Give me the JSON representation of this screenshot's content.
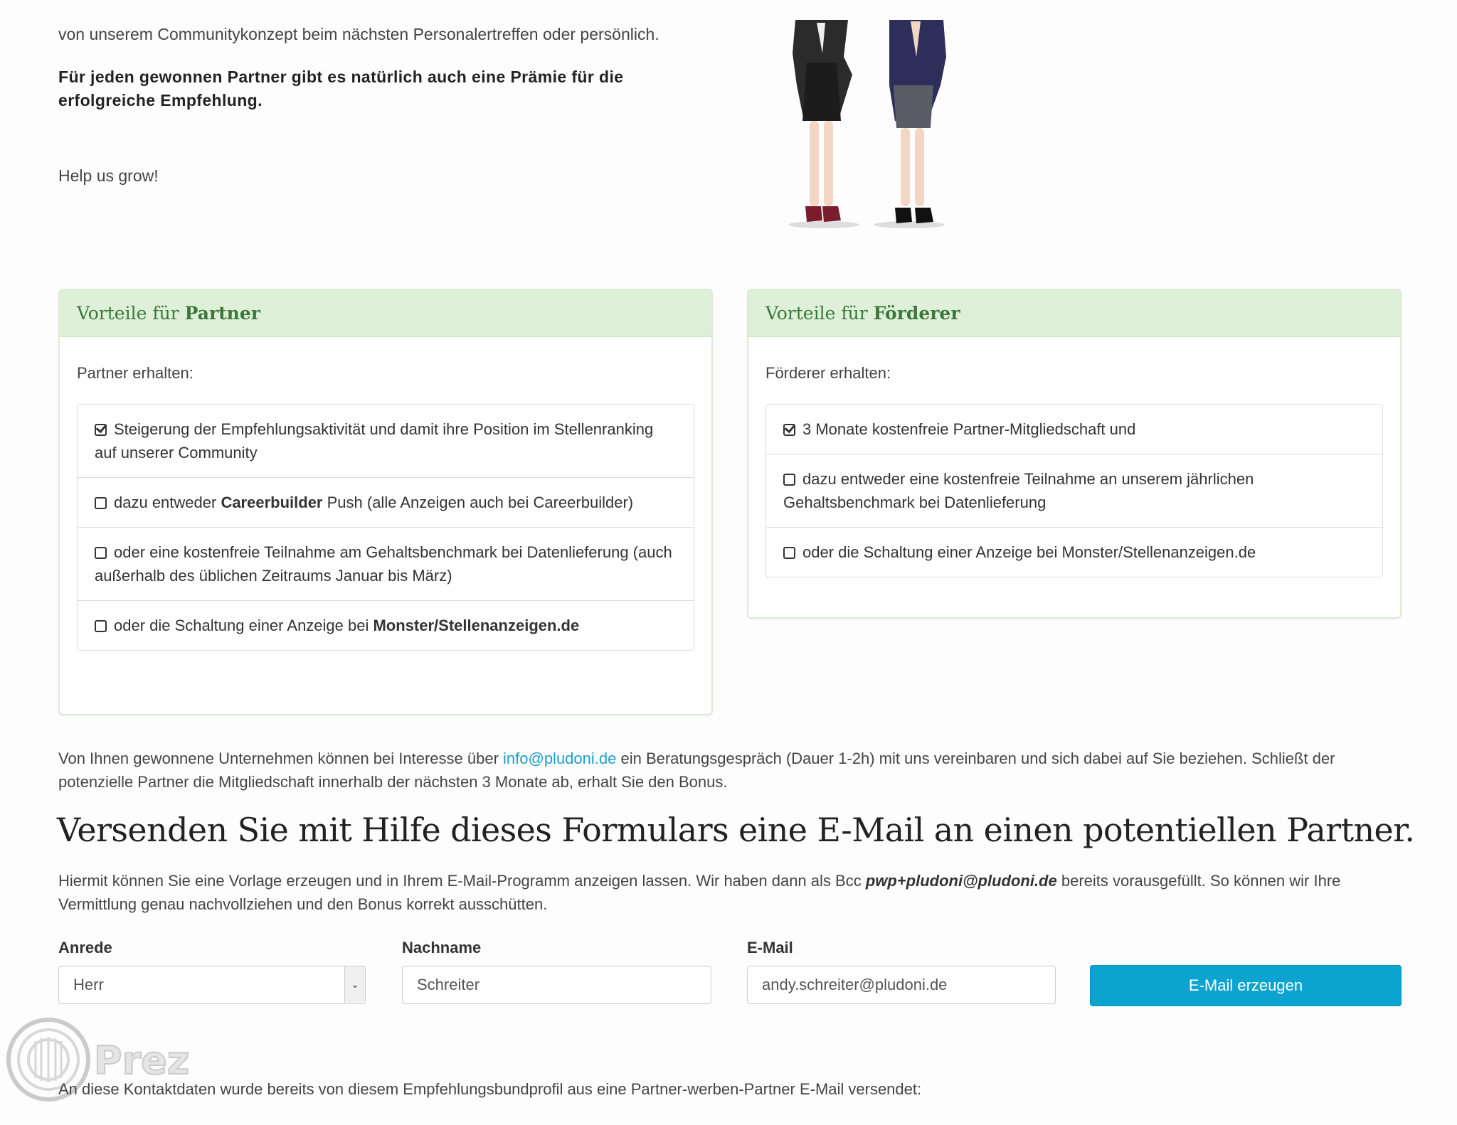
{
  "intro": {
    "text": "von unserem Communitykonzept beim nächsten Personalertreffen oder persönlich.",
    "bold": "Für jeden gewonnen Partner gibt es natürlich auch eine Prämie für die erfolgreiche Empfehlung.",
    "help": "Help us grow!"
  },
  "illustration": {
    "icon": "two-businesswomen-illustration"
  },
  "partner": {
    "title_prefix": "Vorteile für",
    "title_bold": "Partner",
    "lead": "Partner erhalten:",
    "items": [
      {
        "checked": true,
        "text": "Steigerung der Empfehlungsaktivität und damit ihre Position im Stellenranking auf unserer Community"
      },
      {
        "checked": false,
        "pre": "dazu entweder ",
        "bold": "Careerbuilder",
        "post": " Push (alle Anzeigen auch bei Careerbuilder)"
      },
      {
        "checked": false,
        "text": "oder eine kostenfreie Teilnahme am Gehaltsbenchmark bei Datenlieferung (auch außerhalb des üblichen Zeitraums Januar bis März)"
      },
      {
        "checked": false,
        "pre": "oder die Schaltung einer Anzeige bei ",
        "bold": "Monster/Stellenanzeigen.de",
        "post": ""
      }
    ]
  },
  "foerderer": {
    "title_prefix": "Vorteile für",
    "title_bold": "Förderer",
    "lead": "Förderer erhalten:",
    "items": [
      {
        "checked": true,
        "text": "3 Monate kostenfreie Partner-Mitgliedschaft und"
      },
      {
        "checked": false,
        "text": "dazu entweder eine kostenfreie Teilnahme an unserem jährlichen Gehaltsbenchmark bei Datenlieferung"
      },
      {
        "checked": false,
        "text": "oder die Schaltung einer Anzeige bei Monster/Stellenanzeigen.de"
      }
    ]
  },
  "info": {
    "pre": "Von Ihnen gewonnene Unternehmen können bei Interesse über ",
    "link": "info@pludoni.de",
    "post": " ein Beratungsgespräch (Dauer 1-2h) mit uns vereinbaren und sich dabei auf Sie beziehen. Schließt der potenzielle Partner die Mitgliedschaft innerhalb der nächsten 3 Monate ab, erhalt Sie den Bonus."
  },
  "form_section": {
    "heading": "Versenden Sie mit Hilfe dieses Formulars eine E-Mail an einen potentiellen Partner.",
    "desc_pre": "Hiermit können Sie eine Vorlage erzeugen und in Ihrem E-Mail-Programm anzeigen lassen. Wir haben dann als Bcc ",
    "desc_em": "pwp+pludoni@pludoni.de",
    "desc_post": " bereits vorausgefüllt. So können wir Ihre Vermittlung genau nachvollziehen und den Bonus korrekt ausschütten."
  },
  "form": {
    "anrede_label": "Anrede",
    "anrede_value": "Herr",
    "nachname_label": "Nachname",
    "nachname_value": "Schreiter",
    "email_label": "E-Mail",
    "email_value": "andy.schreiter@pludoni.de",
    "submit_label": "E-Mail erzeugen"
  },
  "watermark": {
    "text": "Prezi"
  },
  "footer": {
    "note": "An diese Kontaktdaten wurde bereits von diesem Empfehlungsbundprofil aus eine Partner-werben-Partner E-Mail versendet:"
  },
  "colors": {
    "accent": "#0ba3cf",
    "panel_head": "#dff0d8",
    "panel_text": "#3c763d",
    "link": "#1a9fce"
  }
}
